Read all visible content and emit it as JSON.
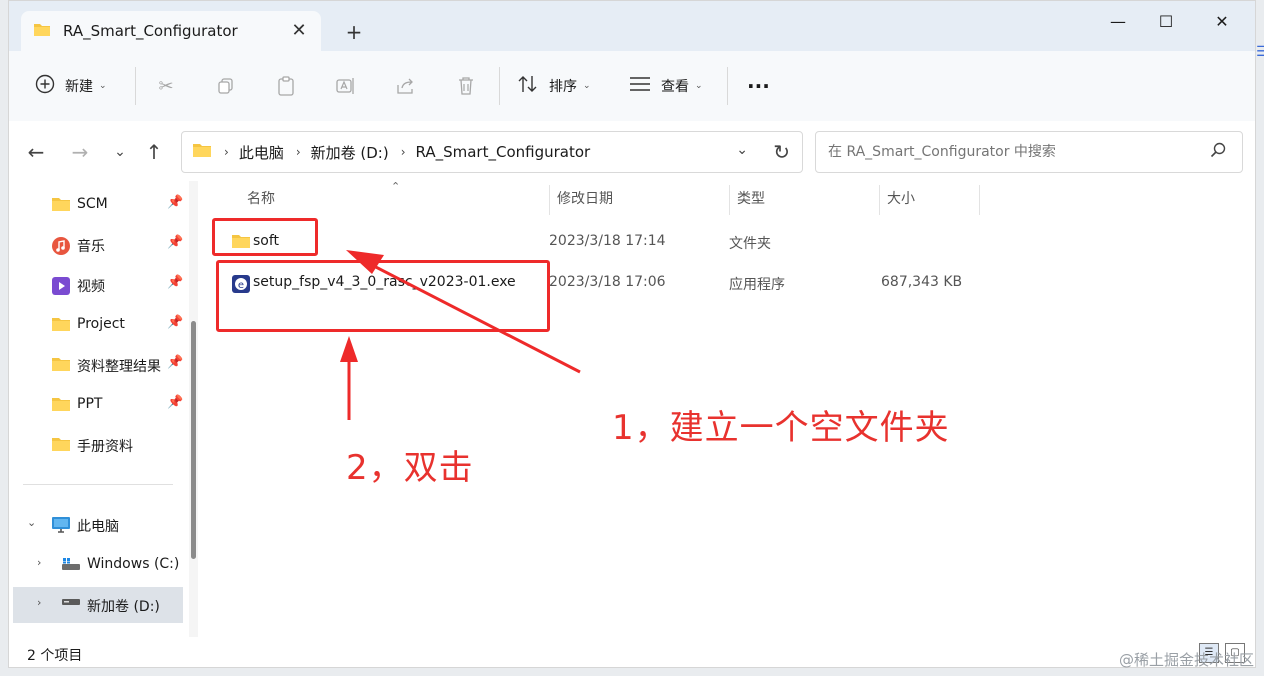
{
  "window": {
    "tab_title": "RA_Smart_Configurator",
    "tab_close": "✕",
    "new_tab": "+",
    "minimize": "—",
    "maximize": "☐",
    "close": "✕"
  },
  "toolbar": {
    "new_label": "新建",
    "sort_label": "排序",
    "view_label": "查看",
    "more_label": "···"
  },
  "nav": {
    "breadcrumbs": [
      "此电脑",
      "新加卷 (D:)",
      "RA_Smart_Configurator"
    ],
    "search_placeholder": "在 RA_Smart_Configurator 中搜索"
  },
  "sidebar": {
    "quick_access": [
      {
        "label": "SCM",
        "icon": "folder-icon"
      },
      {
        "label": "音乐",
        "icon": "music-icon"
      },
      {
        "label": "视频",
        "icon": "video-icon"
      },
      {
        "label": "Project",
        "icon": "folder-icon"
      },
      {
        "label": "资料整理结果",
        "icon": "folder-icon"
      },
      {
        "label": "PPT",
        "icon": "folder-icon"
      },
      {
        "label": "手册资料",
        "icon": "folder-icon"
      }
    ],
    "this_pc": "此电脑",
    "drives": [
      {
        "label": "Windows (C:)",
        "icon": "drive-icon"
      },
      {
        "label": "新加卷 (D:)",
        "icon": "drive-icon"
      }
    ]
  },
  "columns": {
    "name": "名称",
    "modified": "修改日期",
    "type": "类型",
    "size": "大小"
  },
  "files": [
    {
      "name": "soft",
      "modified": "2023/3/18 17:14",
      "type": "文件夹",
      "size": "",
      "icon": "folder-icon"
    },
    {
      "name": "setup_fsp_v4_3_0_rasc_v2023-01.exe",
      "modified": "2023/3/18 17:06",
      "type": "应用程序",
      "size": "687,343 KB",
      "icon": "exe-icon"
    }
  ],
  "status": {
    "item_count": "2 个项目"
  },
  "annotations": {
    "step1": "1，建立一个空文件夹",
    "step2": "2，双击",
    "color": "#e8322e"
  },
  "watermark": "@稀土掘金技术社区"
}
